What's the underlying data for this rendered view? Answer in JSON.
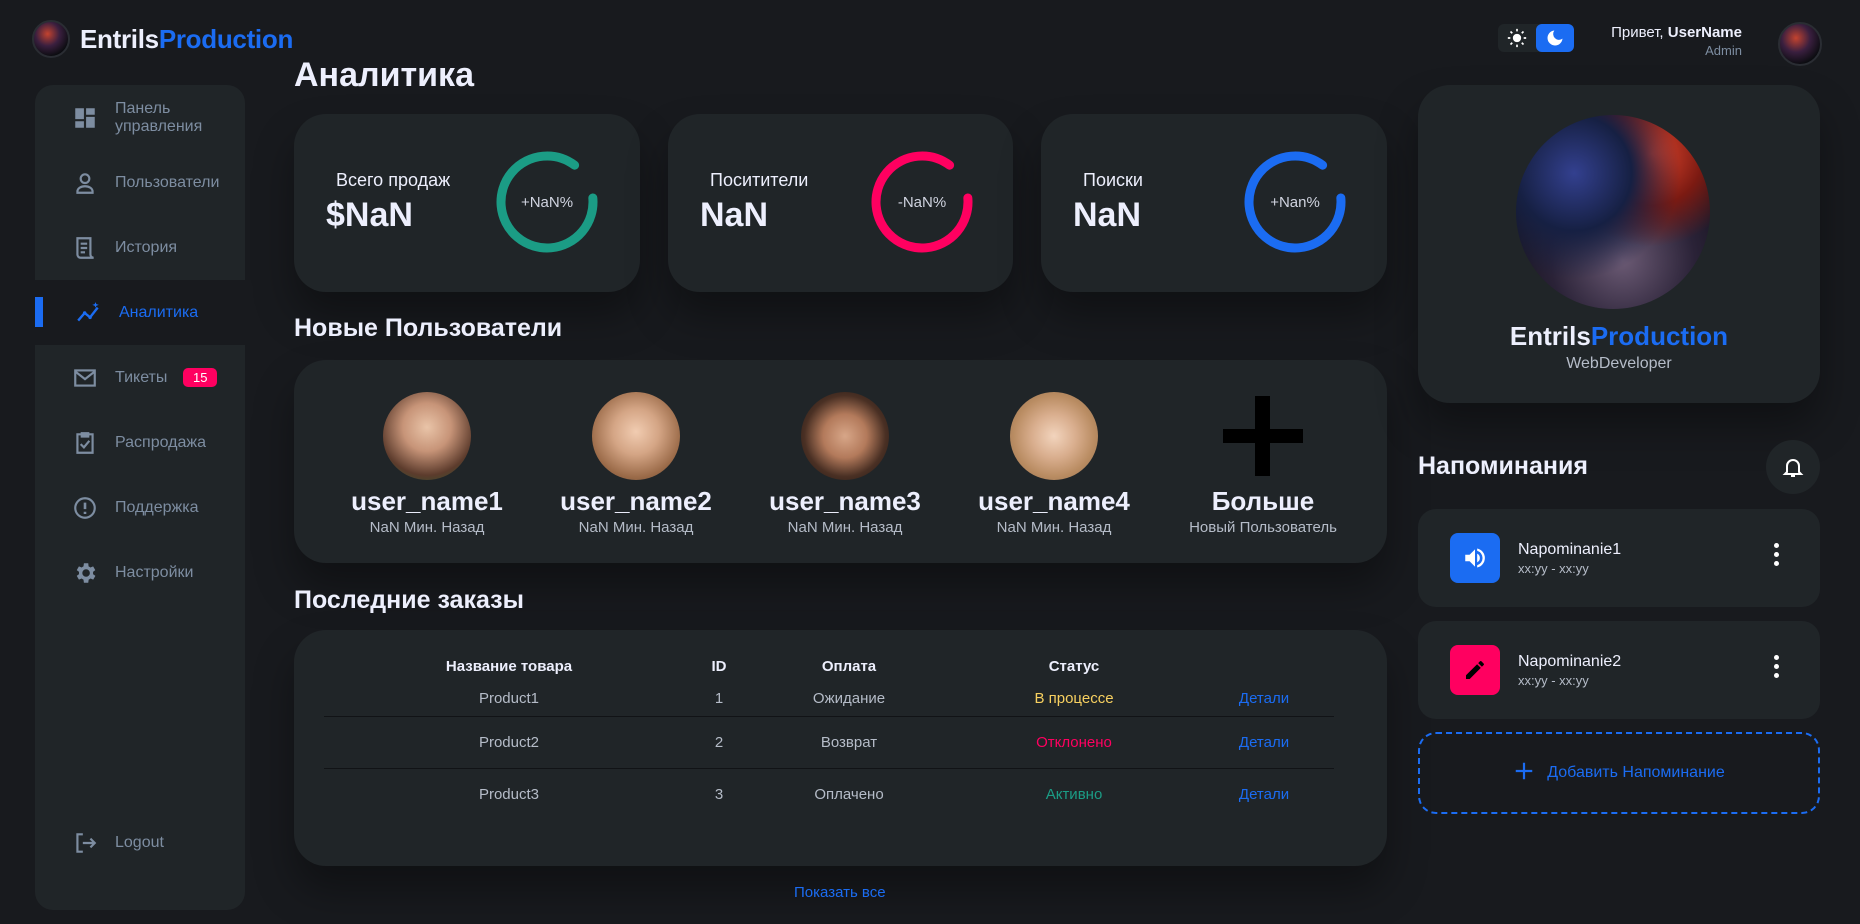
{
  "brand": {
    "part1": "Entrils",
    "part2": "Production"
  },
  "header": {
    "greeting": "Привет,",
    "username": "UserName",
    "role": "Admin"
  },
  "sidebar": {
    "items": [
      {
        "label": "Панель управления",
        "icon": "dashboard-icon"
      },
      {
        "label": "Пользователи",
        "icon": "person-icon"
      },
      {
        "label": "История",
        "icon": "receipt-icon"
      },
      {
        "label": "Аналитика",
        "icon": "insights-icon",
        "active": true
      },
      {
        "label": "Тикеты",
        "icon": "mail-icon",
        "badge": "15"
      },
      {
        "label": "Распродажа",
        "icon": "inventory-icon"
      },
      {
        "label": "Поддержка",
        "icon": "report-icon"
      },
      {
        "label": "Настройки",
        "icon": "gear-icon"
      }
    ],
    "logout": "Logout"
  },
  "main": {
    "title": "Аналитика",
    "stats": [
      {
        "label": "Всего продаж",
        "value": "$NaN",
        "percent": "+NaN%",
        "color": "#1b9c85"
      },
      {
        "label": "Поситители",
        "value": "NaN",
        "percent": "-NaN%",
        "color": "#ff0060"
      },
      {
        "label": "Поиски",
        "value": "NaN",
        "percent": "+Nan%",
        "color": "#1b6cf2"
      }
    ],
    "new_users_title": "Новые Пользователи",
    "new_users": [
      {
        "name": "user_name1",
        "time": "NaN Мин. Назад"
      },
      {
        "name": "user_name2",
        "time": "NaN Мин. Назад"
      },
      {
        "name": "user_name3",
        "time": "NaN Мин. Назад"
      },
      {
        "name": "user_name4",
        "time": "NaN Мин. Назад"
      },
      {
        "name": "Больше",
        "time": "Новый Пользователь"
      }
    ],
    "orders_title": "Последние заказы",
    "orders": {
      "headers": [
        "Название товара",
        "ID",
        "Оплата",
        "Статус",
        ""
      ],
      "rows": [
        {
          "product": "Product1",
          "id": "1",
          "payment": "Ожидание",
          "status": "В процессе",
          "details": "Детали"
        },
        {
          "product": "Product2",
          "id": "2",
          "payment": "Возврат",
          "status": "Отклонено",
          "details": "Детали"
        },
        {
          "product": "Product3",
          "id": "3",
          "payment": "Оплачено",
          "status": "Активно",
          "details": "Детали"
        }
      ]
    },
    "show_all": "Показать все"
  },
  "profile": {
    "name1": "Entrils",
    "name2": "Production",
    "role": "WebDeveloper"
  },
  "reminders": {
    "title": "Напоминания",
    "items": [
      {
        "title": "Napominanie1",
        "time": "xx:yy - xx:yy",
        "icon": "volume-icon",
        "color": "#1b6cf2"
      },
      {
        "title": "Napominanie2",
        "time": "xx:yy - xx:yy",
        "icon": "edit-icon",
        "color": "#ff0060"
      }
    ],
    "add_label": "Добавить Напоминание"
  },
  "colors": {
    "accent": "#1b6cf2",
    "danger": "#ff0060",
    "success": "#1b9c85",
    "warning": "#f7d060",
    "background": "#181a1e",
    "card": "#202528"
  }
}
